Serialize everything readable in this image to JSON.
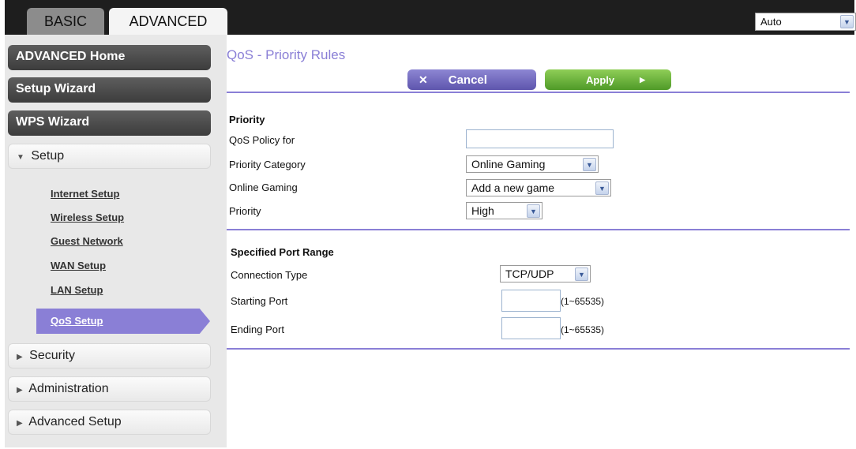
{
  "tabs": {
    "basic": "BASIC",
    "advanced": "ADVANCED"
  },
  "language": {
    "selected": "Auto"
  },
  "sidebar": {
    "advanced_home": "ADVANCED Home",
    "setup_wizard": "Setup Wizard",
    "wps_wizard": "WPS Wizard",
    "setup": "Setup",
    "setup_items": [
      "Internet Setup",
      "Wireless Setup",
      "Guest Network",
      "WAN Setup",
      "LAN Setup"
    ],
    "active_item": "QoS Setup",
    "security": "Security",
    "administration": "Administration",
    "advanced_setup": "Advanced Setup"
  },
  "page": {
    "title": "QoS - Priority Rules",
    "cancel_label": "Cancel",
    "apply_label": "Apply"
  },
  "priority": {
    "heading": "Priority",
    "policy_label": "QoS Policy for",
    "policy_value": "",
    "category_label": "Priority Category",
    "category_value": "Online Gaming",
    "gaming_label": "Online Gaming",
    "gaming_value": "Add a new game",
    "priority_label": "Priority",
    "priority_value": "High"
  },
  "port_range": {
    "heading": "Specified Port Range",
    "connection_label": "Connection Type",
    "connection_value": "TCP/UDP",
    "start_label": "Starting Port",
    "start_value": "",
    "end_label": "Ending Port",
    "end_value": "",
    "range_note": "(1~65535)"
  },
  "icons": {
    "cancel": "x-icon",
    "apply": "arrow-right-icon",
    "dropdown": "chevron-down-icon",
    "expand": "triangle-right-icon",
    "collapse": "triangle-down-icon"
  },
  "colors": {
    "accent": "#8a7fd6",
    "apply": "#6fb13e",
    "dark": "#1e1e1e"
  }
}
